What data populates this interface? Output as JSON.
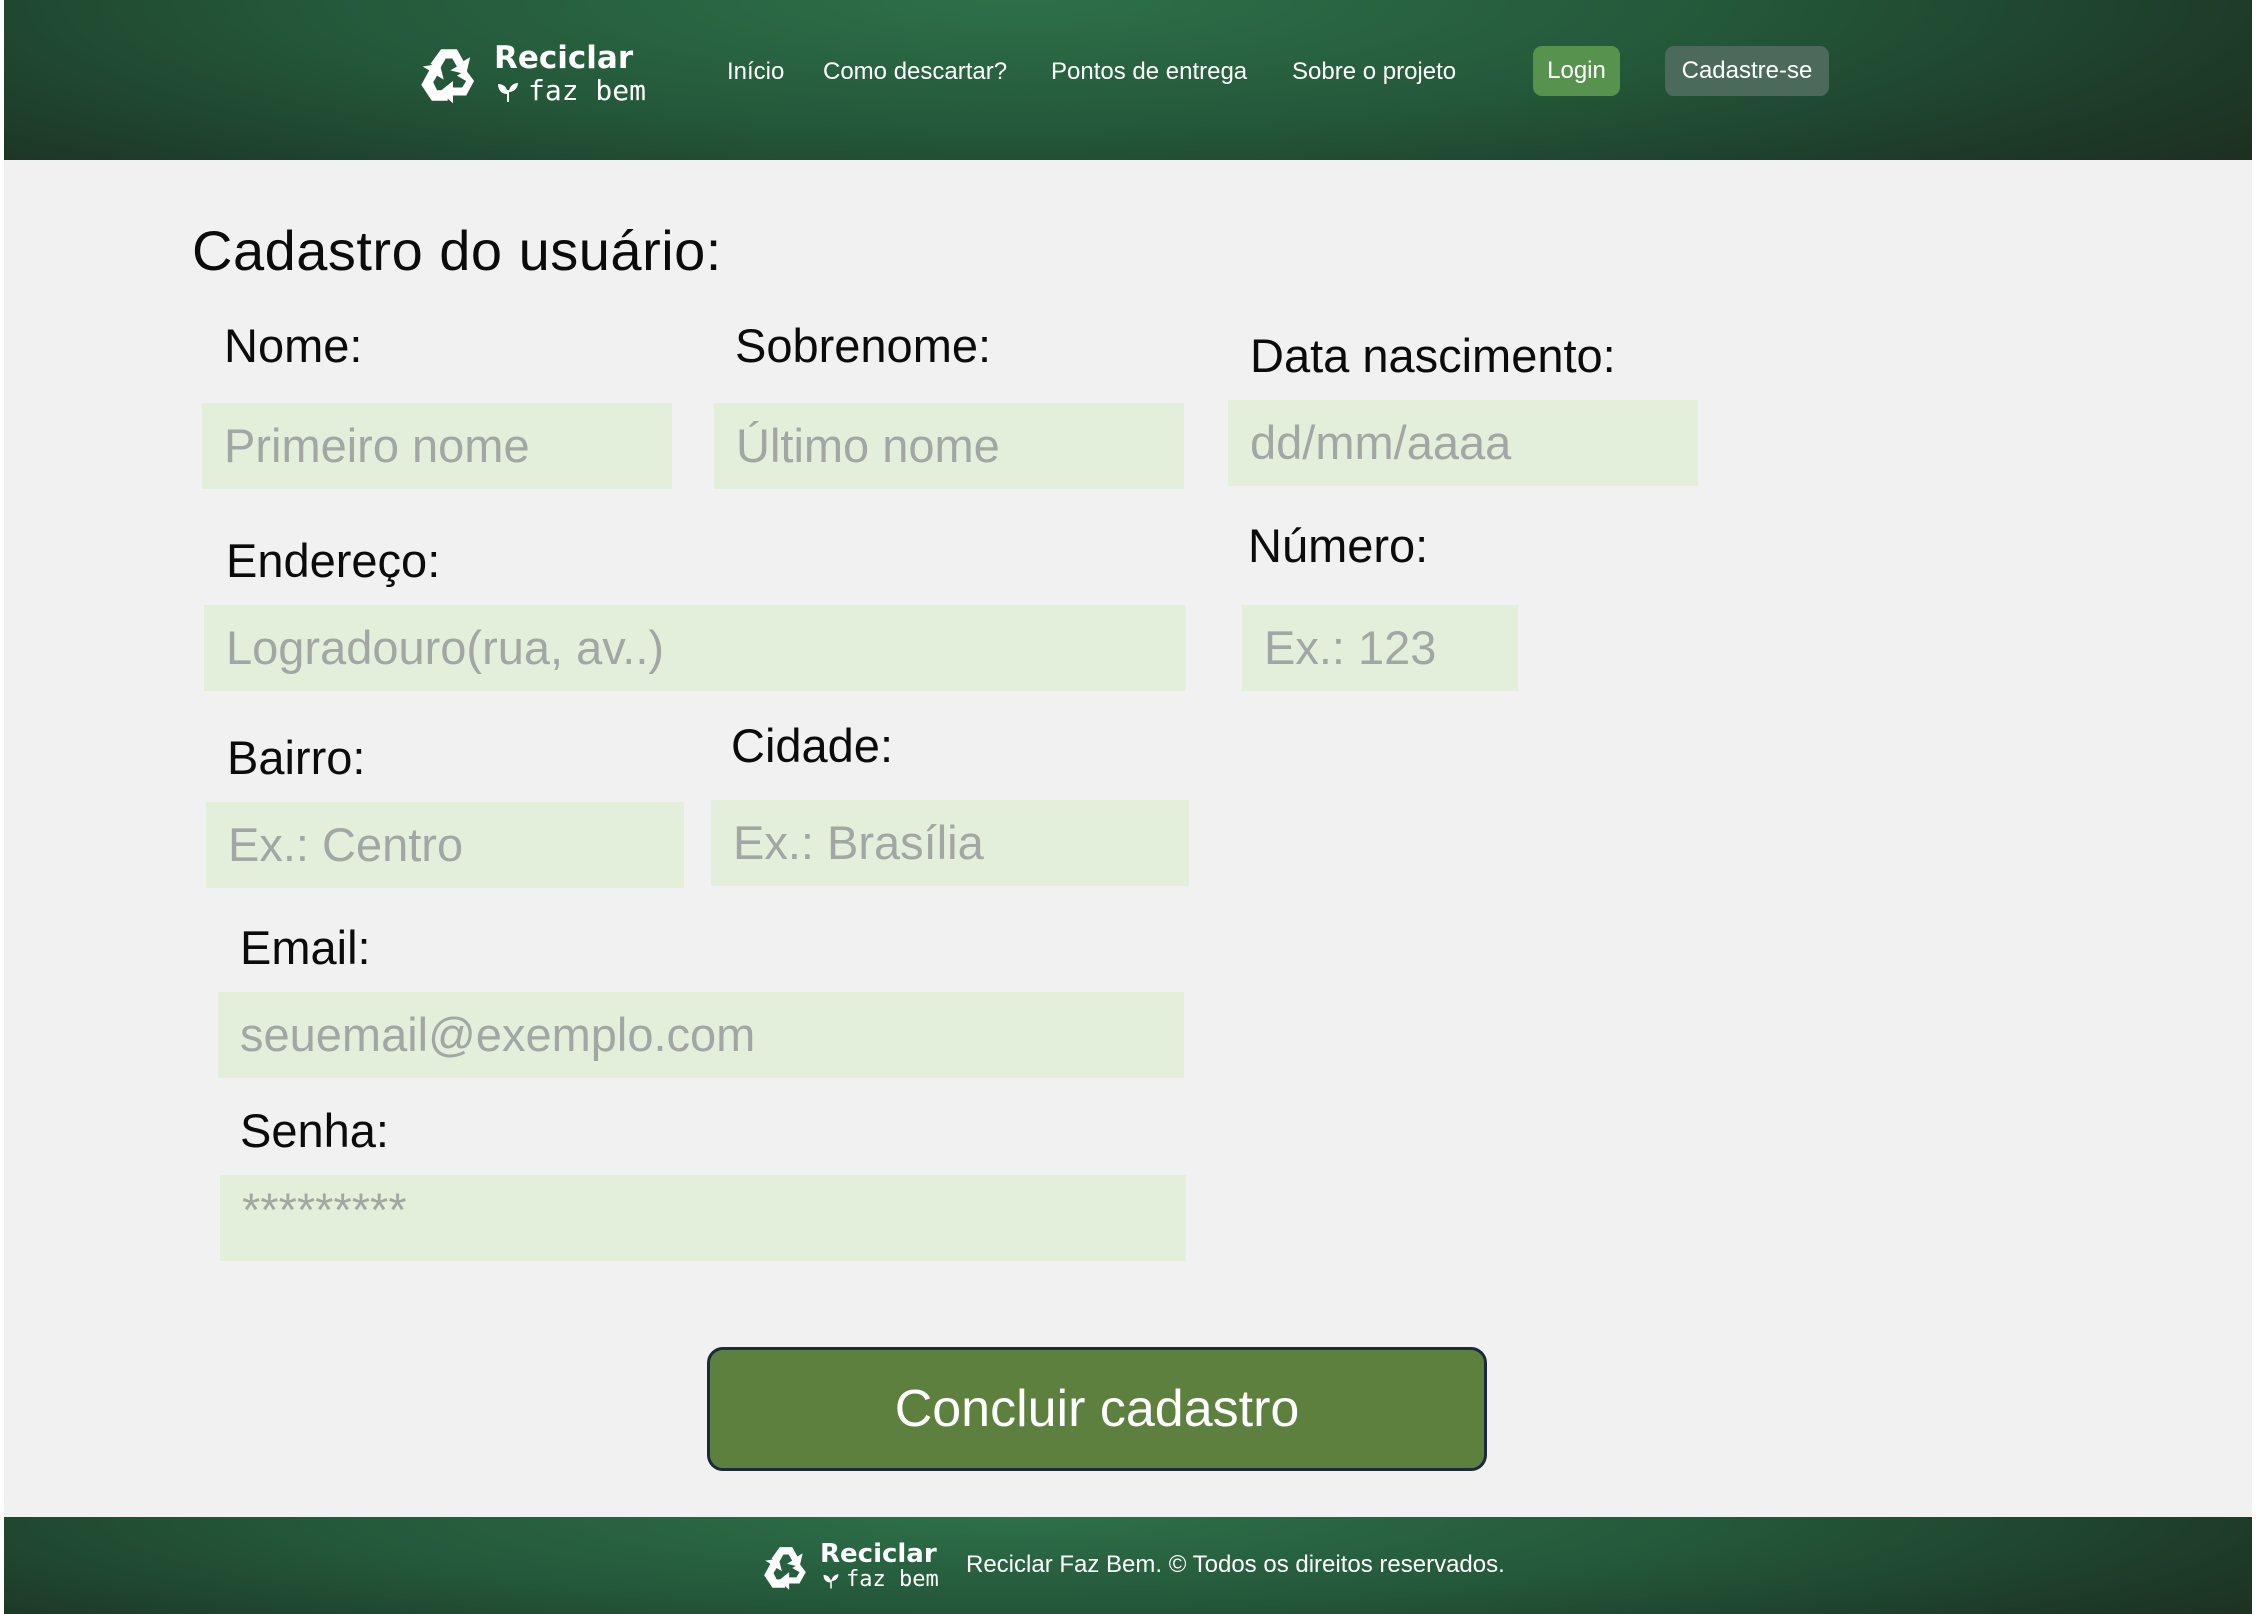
{
  "header": {
    "logo": {
      "name_top": "Reciclar",
      "name_bottom": "faz bem"
    },
    "nav": {
      "inicio": "Início",
      "como_descartar": "Como descartar?",
      "pontos": "Pontos de entrega",
      "sobre": "Sobre o projeto"
    },
    "login_label": "Login",
    "signup_label": "Cadastre-se"
  },
  "form": {
    "title": "Cadastro do usuário:",
    "nome": {
      "label": "Nome:",
      "placeholder": "Primeiro nome"
    },
    "sobrenome": {
      "label": "Sobrenome:",
      "placeholder": "Último nome"
    },
    "data_nascimento": {
      "label": "Data nascimento:",
      "placeholder": "dd/mm/aaaa"
    },
    "endereco": {
      "label": "Endereço:",
      "placeholder": "Logradouro(rua, av..)"
    },
    "numero": {
      "label": "Número:",
      "placeholder": "Ex.: 123"
    },
    "bairro": {
      "label": "Bairro:",
      "placeholder": "Ex.: Centro"
    },
    "cidade": {
      "label": "Cidade:",
      "placeholder": "Ex.: Brasília"
    },
    "email": {
      "label": "Email:",
      "placeholder": "seuemail@exemplo.com"
    },
    "senha": {
      "label": "Senha:",
      "placeholder": "*********"
    },
    "submit_label": "Concluir cadastro"
  },
  "footer": {
    "logo": {
      "name_top": "Reciclar",
      "name_bottom": "faz bem"
    },
    "copyright": "Reciclar Faz Bem. © Todos os direitos reservados."
  },
  "colors": {
    "header_green": "#24583a",
    "field_bg": "#e3efdb",
    "submit_bg": "#5e803f",
    "login_bg": "#57934f",
    "signup_bg": "#4b6a5b"
  },
  "icons": [
    "recycle-icon",
    "leaf-icon"
  ]
}
